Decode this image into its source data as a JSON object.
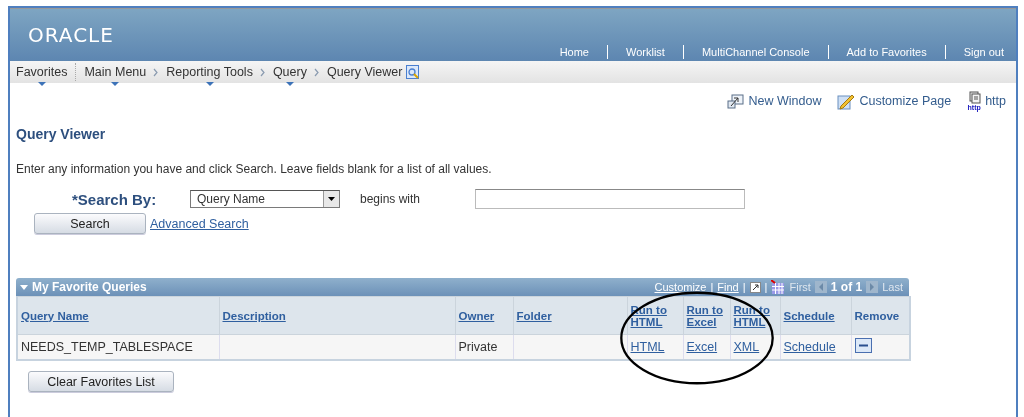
{
  "header": {
    "logo": "ORACLE",
    "nav_links": [
      "Home",
      "Worklist",
      "MultiChannel Console",
      "Add to Favorites",
      "Sign out"
    ]
  },
  "breadcrumbs": [
    {
      "label": "Favorites",
      "menu": true
    },
    {
      "label": "Main Menu",
      "menu": true
    },
    {
      "label": "Reporting Tools",
      "menu": true
    },
    {
      "label": "Query",
      "menu": true
    },
    {
      "label": "Query Viewer",
      "menu": false
    }
  ],
  "page_actions": [
    {
      "kind": "new-window",
      "label": "New Window"
    },
    {
      "kind": "customize",
      "label": "Customize Page"
    },
    {
      "kind": "http",
      "label": "http",
      "icon_caption": "http"
    }
  ],
  "title": "Query Viewer",
  "instructions": "Enter any information you have and click Search. Leave fields blank for a list of all values.",
  "search": {
    "label": "*Search By:",
    "select_value": "Query Name",
    "operator": "begins with",
    "button": "Search",
    "advanced_link": "Advanced Search"
  },
  "grid": {
    "title": "My Favorite Queries",
    "expanded": true,
    "tools": [
      {
        "kind": "link",
        "label": "Customize"
      },
      {
        "kind": "separator",
        "label": "|"
      },
      {
        "kind": "link",
        "label": "Find"
      },
      {
        "kind": "separator",
        "label": "|"
      },
      {
        "kind": "window-icon"
      },
      {
        "kind": "separator",
        "label": "|"
      },
      {
        "kind": "grid-icon"
      }
    ],
    "nav": {
      "first": {
        "label": "First",
        "disabled": true
      },
      "count": "1 of 1",
      "last": {
        "label": "Last",
        "disabled": true
      }
    },
    "columns": [
      {
        "label": "Query Name",
        "kind": "link"
      },
      {
        "label": "Description",
        "kind": "link"
      },
      {
        "label": "Owner",
        "kind": "link"
      },
      {
        "label": "Folder",
        "kind": "link"
      },
      {
        "label": "Run to HTML",
        "kind": "link"
      },
      {
        "label": "Run to Excel",
        "kind": "link"
      },
      {
        "label": "Run to HTML",
        "kind": "link"
      },
      {
        "label": "Schedule",
        "kind": "link"
      },
      {
        "label": "Remove",
        "kind": "plain"
      }
    ],
    "rows": [
      {
        "cells": [
          {
            "kind": "text",
            "text": "NEEDS_TEMP_TABLESPACE"
          },
          {
            "kind": "empty"
          },
          {
            "kind": "text",
            "text": "Private"
          },
          {
            "kind": "empty"
          },
          {
            "kind": "link",
            "text": "HTML"
          },
          {
            "kind": "link",
            "text": "Excel"
          },
          {
            "kind": "link",
            "text": "XML"
          },
          {
            "kind": "link",
            "text": "Schedule"
          },
          {
            "kind": "remove"
          }
        ]
      }
    ]
  },
  "clear_button": "Clear Favorites List"
}
